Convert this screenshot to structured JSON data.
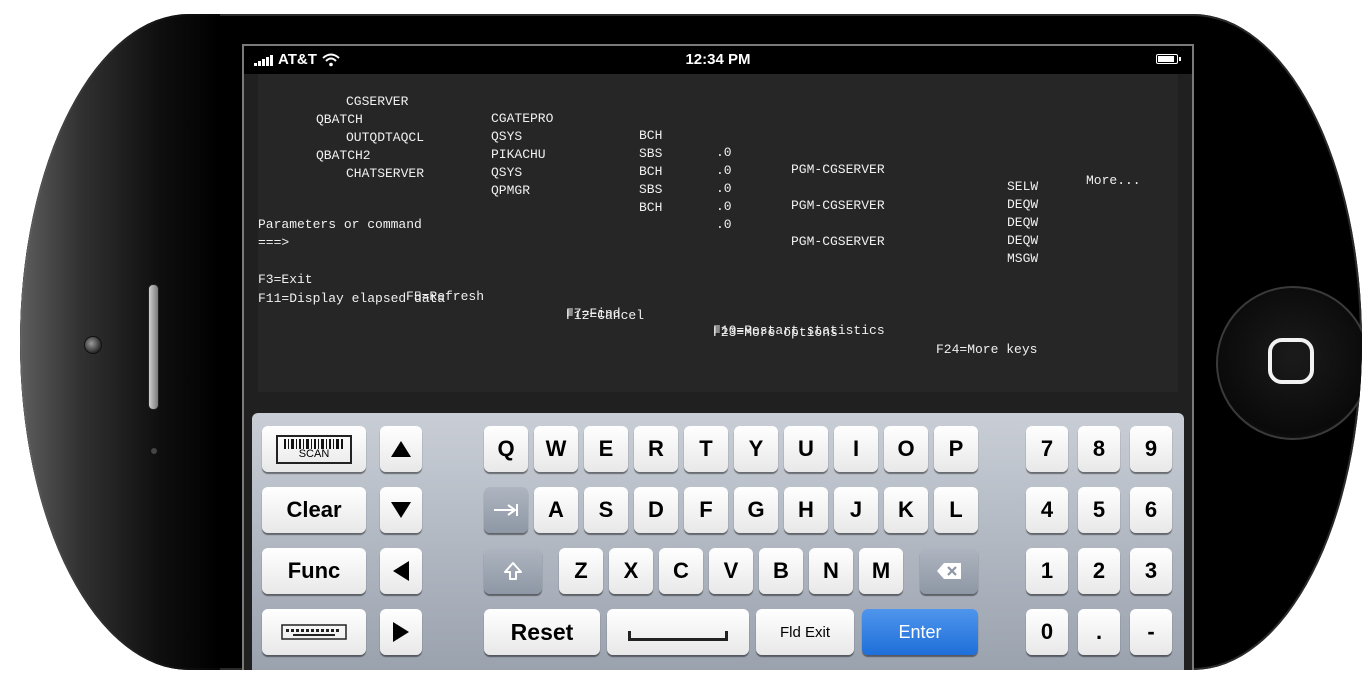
{
  "status_bar": {
    "carrier": "AT&T",
    "time": "12:34 PM"
  },
  "terminal": {
    "rows": [
      {
        "job": "CGSERVER",
        "user": "CGATEPRO",
        "type": "BCH",
        "cpu": ".0",
        "function": "PGM-CGSERVER",
        "status": "SELW"
      },
      {
        "job": "QBATCH",
        "user": "QSYS",
        "type": "SBS",
        "cpu": ".0",
        "function": "",
        "status": "DEQW"
      },
      {
        "job": "OUTQDTAQCL",
        "user": "PIKACHU",
        "type": "BCH",
        "cpu": ".0",
        "function": "PGM-CGSERVER",
        "status": "DEQW"
      },
      {
        "job": "QBATCH2",
        "user": "QSYS",
        "type": "SBS",
        "cpu": ".0",
        "function": "",
        "status": "DEQW"
      },
      {
        "job": "CHATSERVER",
        "user": "QPMGR",
        "type": "BCH",
        "cpu": ".0",
        "function": "PGM-CGSERVER",
        "status": "MSGW"
      }
    ],
    "more": "More...",
    "prompt_label": "Parameters or command",
    "prompt_arrow": "===>",
    "fkeys_line1": [
      "F3=Exit",
      "F5=Refresh",
      "F7=Find",
      "F10=Restart statistics"
    ],
    "fkeys_line2": [
      "F11=Display elapsed data",
      "F12=Cancel",
      "F23=More options",
      "F24=More keys"
    ]
  },
  "keyboard": {
    "scan_label": "SCAN",
    "clear_label": "Clear",
    "func_label": "Func",
    "row1": [
      "Q",
      "W",
      "E",
      "R",
      "T",
      "Y",
      "U",
      "I",
      "O",
      "P"
    ],
    "row2": [
      "A",
      "S",
      "D",
      "F",
      "G",
      "H",
      "J",
      "K",
      "L"
    ],
    "row3": [
      "Z",
      "X",
      "C",
      "V",
      "B",
      "N",
      "M"
    ],
    "reset_label": "Reset",
    "fld_exit_label": "Fld Exit",
    "enter_label": "Enter",
    "numpad": [
      "7",
      "8",
      "9",
      "4",
      "5",
      "6",
      "1",
      "2",
      "3",
      "0",
      ".",
      "-"
    ]
  },
  "colors": {
    "enter_key": "#2a7ae2",
    "terminal_bg": "#262626",
    "keyboard_bg": "#b4bac4"
  }
}
